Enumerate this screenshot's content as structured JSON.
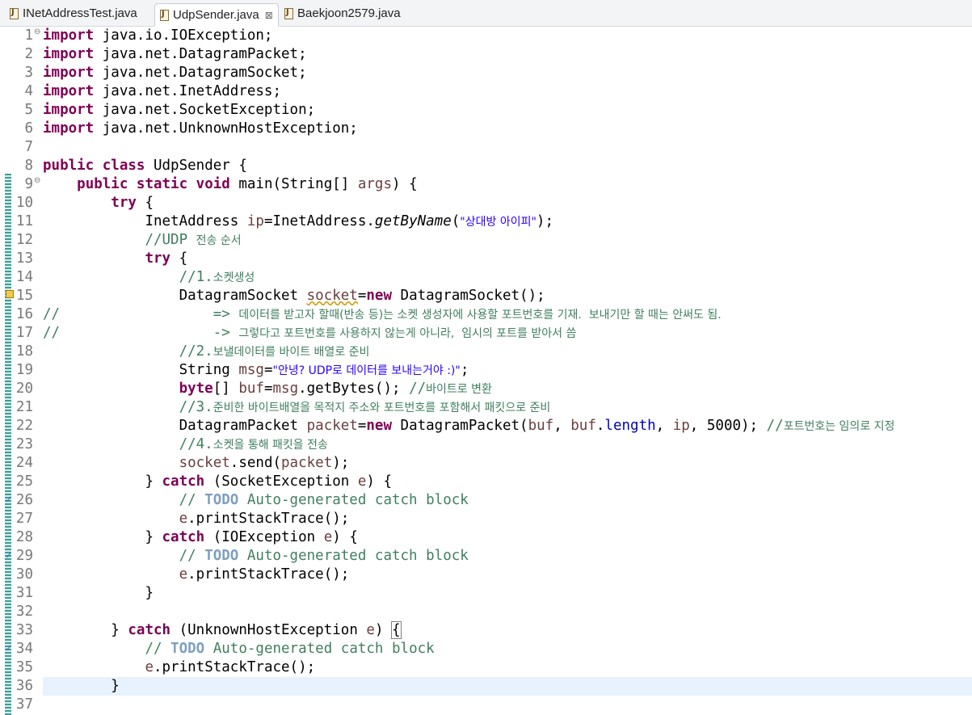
{
  "tabs": [
    {
      "label": "INetAddressTest.java"
    },
    {
      "label": "UdpSender.java",
      "close": "⊠"
    },
    {
      "label": "Baekjoon2579.java"
    }
  ],
  "lines": [
    {
      "n": "1",
      "fold": "⊖"
    },
    {
      "n": "2"
    },
    {
      "n": "3"
    },
    {
      "n": "4"
    },
    {
      "n": "5"
    },
    {
      "n": "6"
    },
    {
      "n": "7"
    },
    {
      "n": "8"
    },
    {
      "n": "9",
      "fold": "⊖"
    },
    {
      "n": "10"
    },
    {
      "n": "11"
    },
    {
      "n": "12"
    },
    {
      "n": "13"
    },
    {
      "n": "14"
    },
    {
      "n": "15"
    },
    {
      "n": "16"
    },
    {
      "n": "17"
    },
    {
      "n": "18"
    },
    {
      "n": "19"
    },
    {
      "n": "20"
    },
    {
      "n": "21"
    },
    {
      "n": "22"
    },
    {
      "n": "23"
    },
    {
      "n": "24"
    },
    {
      "n": "25"
    },
    {
      "n": "26"
    },
    {
      "n": "27"
    },
    {
      "n": "28"
    },
    {
      "n": "29"
    },
    {
      "n": "30"
    },
    {
      "n": "31"
    },
    {
      "n": "32"
    },
    {
      "n": "33"
    },
    {
      "n": "34"
    },
    {
      "n": "35"
    },
    {
      "n": "36"
    },
    {
      "n": "37"
    }
  ],
  "code": {
    "l1": {
      "kw": "import",
      "rest": " java.io.IOException;"
    },
    "l2": {
      "kw": "import",
      "rest": " java.net.DatagramPacket;"
    },
    "l3": {
      "kw": "import",
      "rest": " java.net.DatagramSocket;"
    },
    "l4": {
      "kw": "import",
      "rest": " java.net.InetAddress;"
    },
    "l5": {
      "kw": "import",
      "rest": " java.net.SocketException;"
    },
    "l6": {
      "kw": "import",
      "rest": " java.net.UnknownHostException;"
    },
    "l8": {
      "kw": "public class",
      "rest": " UdpSender {"
    },
    "l9": {
      "kw": "public static void",
      "a": " main(String[] ",
      "par": "args",
      "b": ") {"
    },
    "l10": {
      "kw": "try",
      "rest": " {"
    },
    "l11": {
      "a": "InetAddress ",
      "loc": "ip",
      "b": "=InetAddress.",
      "it": "getByName",
      "c": "(",
      "str": "\"상대방 아이피\"",
      "d": ");"
    },
    "l12": {
      "cm": "//UDP ",
      "ko": "전송 순서"
    },
    "l13": {
      "kw": "try",
      "rest": " {"
    },
    "l14": {
      "cm": "//1.",
      "ko": "소켓생성"
    },
    "l15": {
      "a": "DatagramSocket ",
      "loc": "socket",
      "b": "=",
      "kw": "new",
      "c": " DatagramSocket();"
    },
    "l16": {
      "cm": "//                  => ",
      "ko": "데이터를 받고자 할때(반송 등)는 소켓 생성자에 사용할 포트번호를 기재.  보내기만 할 때는 안써도 됨."
    },
    "l17": {
      "cm": "//                  -> ",
      "ko": "그렇다고 포트번호를 사용하지 않는게 아니라,  임시의 포트를 받아서 씀"
    },
    "l18": {
      "cm": "//2.",
      "ko": "보낼데이터를 바이트 배열로 준비"
    },
    "l19": {
      "a": "String ",
      "loc": "msg",
      "b": "=",
      "str": "\"안녕? UDP로 데이터를 보내는거야 :)\"",
      "c": ";"
    },
    "l20": {
      "kw": "byte",
      "a": "[] ",
      "loc": "buf",
      "b": "=",
      "loc2": "msg",
      "c": ".getBytes(); ",
      "cm": "//",
      "ko": "바이트로 변환"
    },
    "l21": {
      "cm": "//3.",
      "ko": "준비한 바이트배열을 목적지 주소와 포트번호를 포함해서 패킷으로 준비"
    },
    "l22": {
      "a": "DatagramPacket ",
      "loc": "packet",
      "b": "=",
      "kw": "new",
      "c": " DatagramPacket(",
      "l1": "buf",
      "d": ", ",
      "l2": "buf",
      "e": ".",
      "fld": "length",
      "f": ", ",
      "l3": "ip",
      "g": ", 5000); ",
      "cm": "//",
      "ko": "포트번호는 임의로 지정"
    },
    "l23": {
      "cm": "//4.",
      "ko": "소켓을 통해 패킷을 전송"
    },
    "l24": {
      "loc": "socket",
      "a": ".send(",
      "loc2": "packet",
      "b": ");"
    },
    "l25": {
      "a": "} ",
      "kw": "catch",
      "b": " (SocketException ",
      "par": "e",
      "c": ") {"
    },
    "l26": {
      "cm": "// ",
      "todo": "TODO",
      "cm2": " Auto-generated catch block"
    },
    "l27": {
      "par": "e",
      "a": ".printStackTrace();"
    },
    "l28": {
      "a": "} ",
      "kw": "catch",
      "b": " (IOException ",
      "par": "e",
      "c": ") {"
    },
    "l29": {
      "cm": "// ",
      "todo": "TODO",
      "cm2": " Auto-generated catch block"
    },
    "l30": {
      "par": "e",
      "a": ".printStackTrace();"
    },
    "l31": {
      "a": "}"
    },
    "l33": {
      "a": "} ",
      "kw": "catch",
      "b": " (UnknownHostException ",
      "par": "e",
      "c": ") ",
      "brk": "{"
    },
    "l34": {
      "cm": "// ",
      "todo": "TODO",
      "cm2": " Auto-generated catch block"
    },
    "l35": {
      "par": "e",
      "a": ".printStackTrace();"
    },
    "l36": {
      "a": "}"
    }
  },
  "colors": {
    "keyword": "#7f0055",
    "comment": "#3f7f5f",
    "string": "#2a00ff",
    "field": "#0000c0",
    "todo": "#7f9fbf",
    "current_line": "#e8f2fe"
  }
}
